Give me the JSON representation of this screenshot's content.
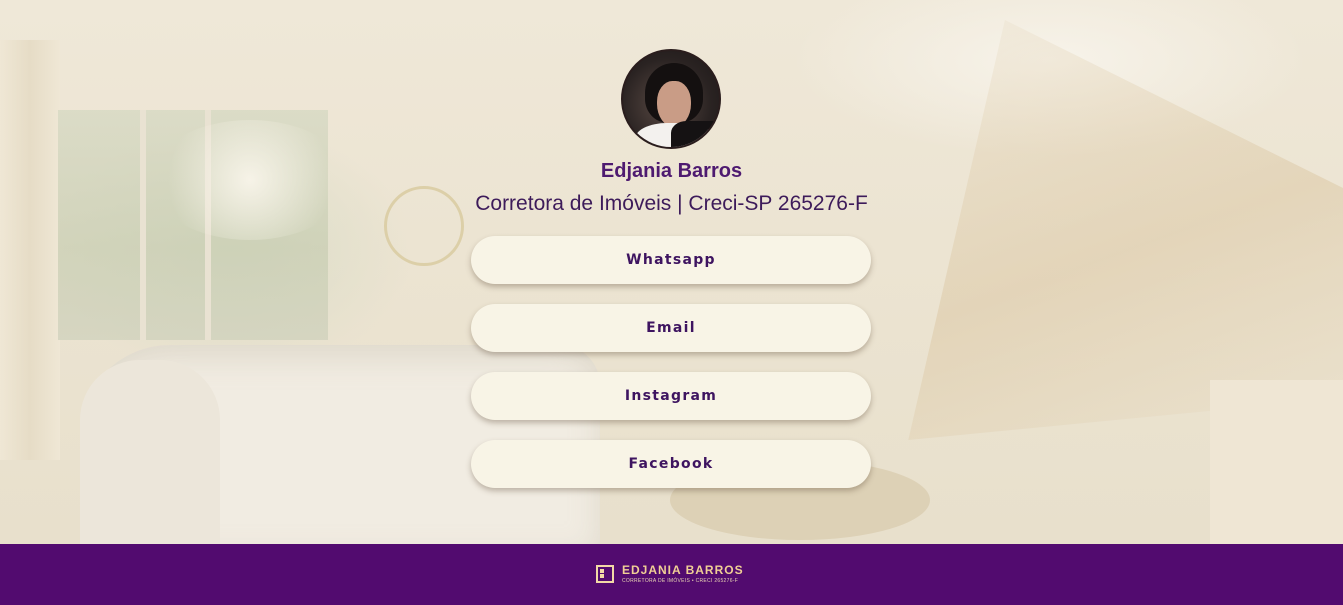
{
  "profile": {
    "name": "Edjania Barros",
    "subtitle": "Corretora de Imóveis | Creci-SP 265276-F",
    "avatar_icon": "profile-photo"
  },
  "links": [
    {
      "label": "Whatsapp"
    },
    {
      "label": "Email"
    },
    {
      "label": "Instagram"
    },
    {
      "label": "Facebook"
    }
  ],
  "footer": {
    "logo_name": "EDJANIA BARROS",
    "logo_tagline": "CORRETORA DE IMÓVEIS • CRECI 265276-F",
    "logo_icon": "building-logo-icon"
  },
  "colors": {
    "accent": "#520b6f",
    "button_bg": "#f8f4e6",
    "text_purple": "#4e1a70",
    "logo_gold": "#f0cf95"
  }
}
